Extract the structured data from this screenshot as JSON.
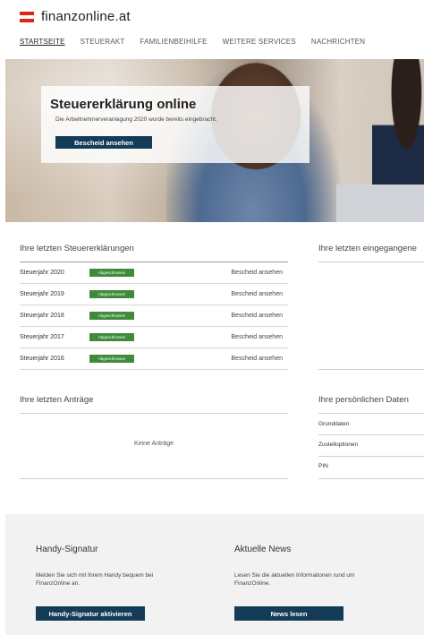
{
  "header": {
    "brand": "finanzonline.at",
    "nav": [
      "STARTSEITE",
      "STEUERAKT",
      "FAMILIENBEIHILFE",
      "WEITERE SERVICES",
      "NACHRICHTEN"
    ]
  },
  "hero": {
    "title": "Steuererklärung online",
    "subtitle": "Die Arbeitnehmerveranlagung 2020 wurde bereits eingebracht.",
    "button": "Bescheid ansehen"
  },
  "returns": {
    "title": "Ihre letzten Steuererklärungen",
    "rows": [
      {
        "year": "Steuerjahr 2020",
        "status": "Abgeschlossen",
        "link": "Bescheid ansehen"
      },
      {
        "year": "Steuerjahr 2019",
        "status": "Abgeschlossen",
        "link": "Bescheid ansehen"
      },
      {
        "year": "Steuerjahr 2018",
        "status": "Abgeschlossen",
        "link": "Bescheid ansehen"
      },
      {
        "year": "Steuerjahr 2017",
        "status": "Abgeschlossen",
        "link": "Bescheid ansehen"
      },
      {
        "year": "Steuerjahr 2016",
        "status": "Abgeschlossen",
        "link": "Bescheid ansehen"
      }
    ]
  },
  "incoming": {
    "title": "Ihre letzten eingegangene"
  },
  "applications": {
    "title": "Ihre letzten Anträge",
    "empty": "Keine Anträge"
  },
  "personal": {
    "title": "Ihre persönlichen Daten",
    "items": [
      "Grunddaten",
      "Zustelloptionen",
      "PIN"
    ]
  },
  "footer": {
    "signature": {
      "title": "Handy-Signatur",
      "text": "Melden Sie sich mit Ihrem Handy bequem bei FinanzOnline an.",
      "button": "Handy-Signatur aktivieren"
    },
    "news": {
      "title": "Aktuelle News",
      "text": "Lesen Sie die aktuellen Informationen rund um FinanzOnline.",
      "button": "News lesen"
    }
  },
  "colors": {
    "primary": "#143c59",
    "success": "#3e8b3b",
    "flag_red": "#e2231a"
  }
}
